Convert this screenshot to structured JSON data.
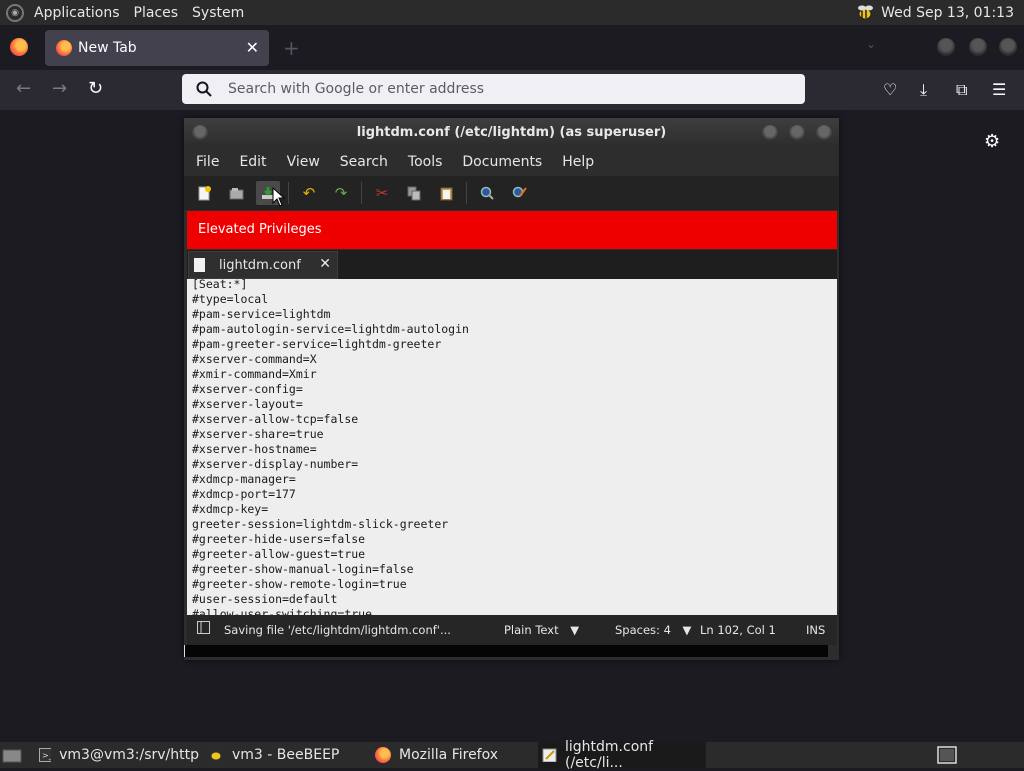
{
  "top_panel": {
    "menus": [
      "Applications",
      "Places",
      "System"
    ],
    "clock": "Wed Sep 13, 01:13",
    "tray_icon": "beebeep-tray-icon"
  },
  "firefox": {
    "tab_title": "New Tab",
    "url_placeholder": "Search with Google or enter address",
    "toolbar_icons": [
      "pocket-icon",
      "download-icon",
      "extensions-icon",
      "menu-icon"
    ]
  },
  "gedit": {
    "title": "lightdm.conf (/etc/lightdm) (as superuser)",
    "menu": [
      "File",
      "Edit",
      "View",
      "Search",
      "Tools",
      "Documents",
      "Help"
    ],
    "banner": "Elevated Privileges",
    "tab_label": "lightdm.conf",
    "lines": [
      "[Seat:*]",
      "#type=local",
      "#pam-service=lightdm",
      "#pam-autologin-service=lightdm-autologin",
      "#pam-greeter-service=lightdm-greeter",
      "#xserver-command=X",
      "#xmir-command=Xmir",
      "#xserver-config=",
      "#xserver-layout=",
      "#xserver-allow-tcp=false",
      "#xserver-share=true",
      "#xserver-hostname=",
      "#xserver-display-number=",
      "#xdmcp-manager=",
      "#xdmcp-port=177",
      "#xdmcp-key=",
      "greeter-session=lightdm-slick-greeter",
      "#greeter-hide-users=false",
      "#greeter-allow-guest=true",
      "#greeter-show-manual-login=false",
      "#greeter-show-remote-login=true",
      "#user-session=default",
      "#allow-user-switching=true"
    ],
    "status": {
      "message": "Saving file '/etc/lightdm/lightdm.conf'...",
      "language": "Plain Text",
      "spaces": "Spaces: 4",
      "position": "Ln 102, Col 1",
      "mode": "INS"
    }
  },
  "taskbar": {
    "tasks": [
      {
        "label": "vm3@vm3:/srv/http",
        "icon": "terminal-icon"
      },
      {
        "label": "vm3 - BeeBEEP",
        "icon": "beebeep-icon"
      },
      {
        "label": "Mozilla Firefox",
        "icon": "firefox-icon"
      },
      {
        "label": "lightdm.conf (/etc/li...",
        "icon": "text-editor-icon"
      }
    ]
  }
}
